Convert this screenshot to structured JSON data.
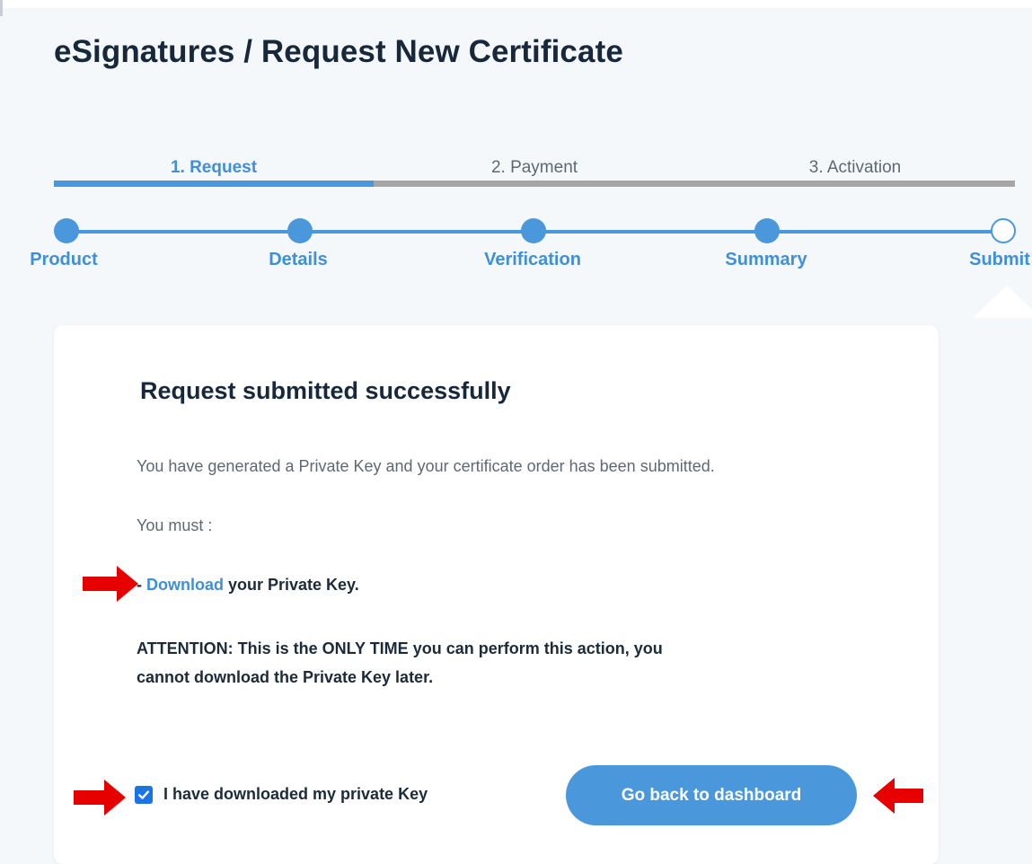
{
  "page": {
    "title": "eSignatures / Request New Certificate"
  },
  "progress_tabs": [
    {
      "label": "1. Request",
      "active": true
    },
    {
      "label": "2. Payment",
      "active": false
    },
    {
      "label": "3. Activation",
      "active": false
    }
  ],
  "steps": [
    {
      "label": "Product",
      "state": "done"
    },
    {
      "label": "Details",
      "state": "done"
    },
    {
      "label": "Verification",
      "state": "done"
    },
    {
      "label": "Summary",
      "state": "done"
    },
    {
      "label": "Submit",
      "state": "current"
    }
  ],
  "card": {
    "title": "Request submitted successfully",
    "message": "You have generated a Private Key and your certificate order has been submitted.",
    "must_label": "You must :",
    "download_prefix": "- ",
    "download_link": "Download",
    "download_suffix": " your Private Key.",
    "attention_text": "ATTENTION: This is the ONLY TIME you can perform this action, you cannot download the Private Key later.",
    "checkbox_label": "I have downloaded my private Key",
    "checkbox_checked": true,
    "button_label": "Go back to dashboard"
  },
  "colors": {
    "accent": "#4a98db",
    "background": "#f5f8fb",
    "inactive_bar": "#a6a6a6",
    "checkbox": "#1a73e8",
    "annotation_arrow": "#e60000"
  },
  "icons": [
    "checkmark-icon",
    "red-arrow-right-icon",
    "red-arrow-left-icon"
  ]
}
